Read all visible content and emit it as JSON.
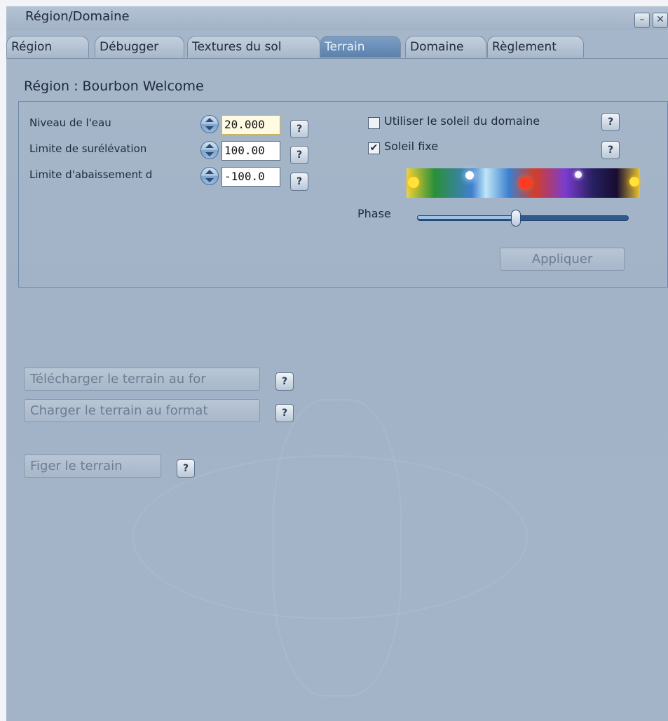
{
  "window": {
    "title": "Région/Domaine",
    "minimize_icon": "minimize-icon",
    "close_icon": "close-icon",
    "minimize_glyph": "–",
    "close_glyph": "✕"
  },
  "tabs": [
    {
      "label": "Région",
      "active": false
    },
    {
      "label": "Débugger",
      "active": false
    },
    {
      "label": "Textures du sol",
      "active": false
    },
    {
      "label": "Terrain",
      "active": true
    },
    {
      "label": "Domaine",
      "active": false
    },
    {
      "label": "Règlement",
      "active": false
    }
  ],
  "region_label": "Région :  Bourbon Welcome",
  "terrain": {
    "water_level_label": "Niveau de l'eau",
    "water_level_value": "20.000",
    "raise_limit_label": "Limite de surélévation",
    "raise_limit_value": "100.00",
    "lower_limit_label": "Limite d'abaissement d",
    "lower_limit_value": "-100.0",
    "help_glyph": "?"
  },
  "sun": {
    "use_estate_sun_label": "Utiliser le soleil du domaine",
    "use_estate_sun_checked": false,
    "fixed_sun_label": "Soleil fixe",
    "fixed_sun_checked": true,
    "check_glyph": "✔",
    "phase_label": "Phase",
    "phase_value": 0.47,
    "apply_label": "Appliquer"
  },
  "actions": {
    "download_label": "Télécharger le terrain au for",
    "upload_label": "Charger le terrain au format",
    "bake_label": "Figer le terrain"
  },
  "colors": {
    "active_tab": "#5a80ad",
    "panel_border": "#6d87a8",
    "background": "#a4b4c8"
  }
}
